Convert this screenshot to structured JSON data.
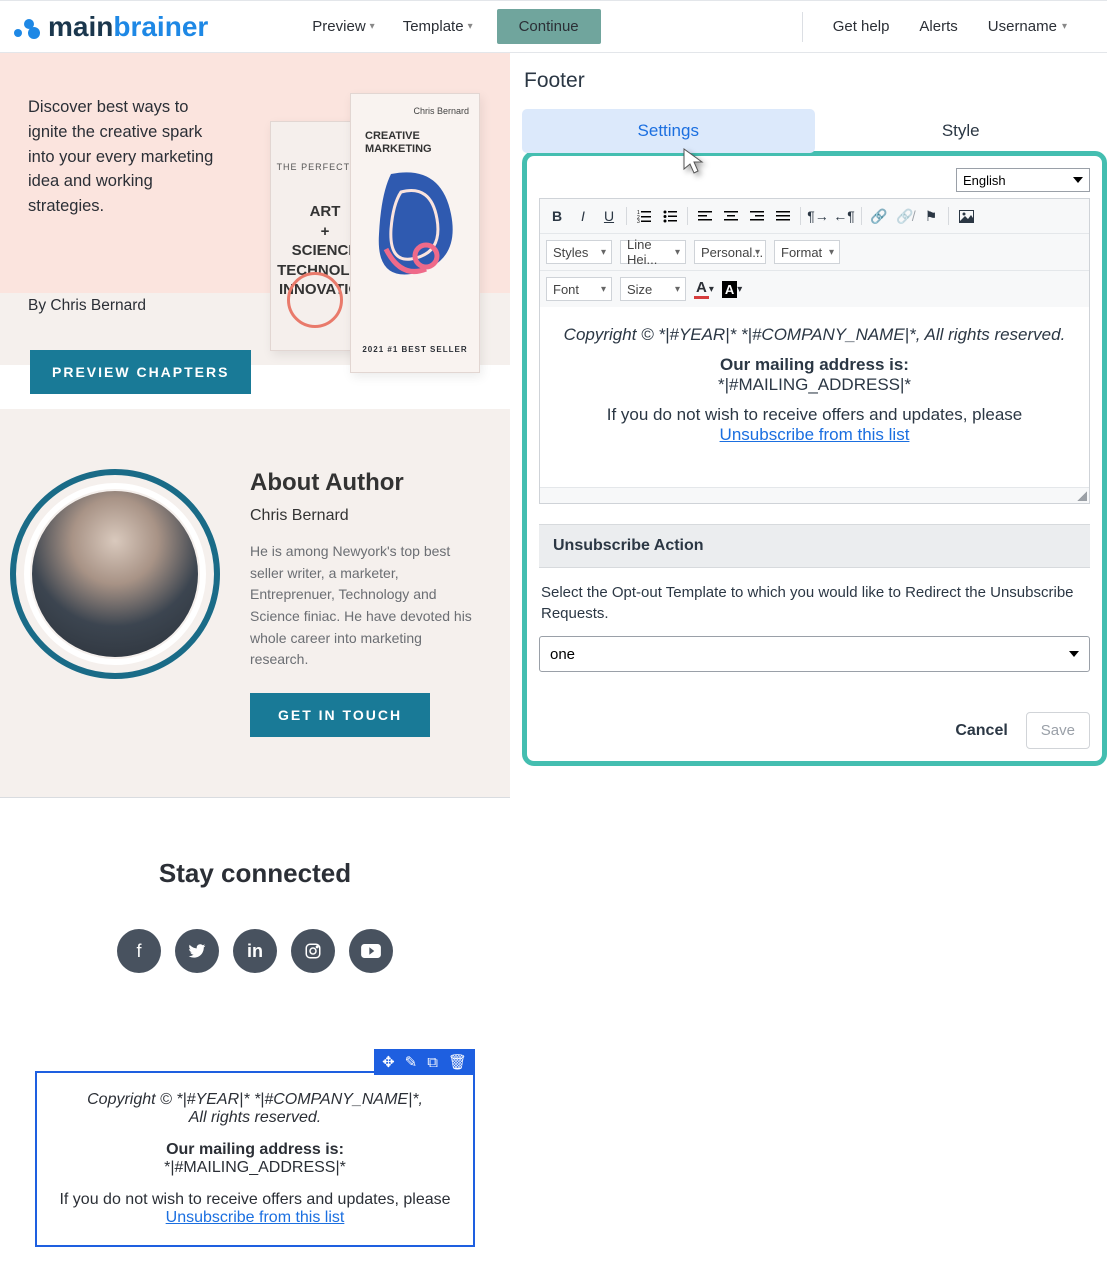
{
  "topbar": {
    "logo_main": "main",
    "logo_brain": "brainer",
    "preview": "Preview",
    "template": "Template",
    "continue": "Continue",
    "get_help": "Get help",
    "alerts": "Alerts",
    "username": "Username"
  },
  "hero": {
    "text": "Discover best ways to ignite the creative spark into your every marketing idea and working strategies.",
    "by": "By Chris Bernard",
    "book_back_sub": "THE PERFECT BLE",
    "book_back_art": "ART\n+\nSCIENCE\nTECHNOLOG\nINNOVATION",
    "book_front_author": "Chris Bernard",
    "book_front_title": "CREATIVE\nMARKETING",
    "book_front_bs": "2021 #1 BEST SELLER",
    "preview_btn": "PREVIEW CHAPTERS"
  },
  "about": {
    "h": "About Author",
    "name": "Chris Bernard",
    "bio": "He is among Newyork's top best seller writer, a marketer, Entreprenuer, Technology and Science finiac. He have devoted his whole career into marketing research.",
    "btn": "GET IN TOUCH"
  },
  "stay": {
    "h": "Stay connected"
  },
  "footer_block": {
    "copy": "Copyright © *|#YEAR|* *|#COMPANY_NAME|*,",
    "rights": "All rights reserved.",
    "mail_h": "Our mailing address is:",
    "mail_v": "*|#MAILING_ADDRESS|*",
    "wish": "If you do not wish to receive offers and updates, please",
    "unsub": "Unsubscribe from this list"
  },
  "panel": {
    "title": "Footer",
    "tab_settings": "Settings",
    "tab_style": "Style",
    "language": "English",
    "rte": {
      "styles": "Styles",
      "lh": "Line Hei...",
      "pers": "Personal...",
      "fmt": "Format",
      "font": "Font",
      "size": "Size",
      "copy": "Copyright © *|#YEAR|* *|#COMPANY_NAME|*, All rights reserved.",
      "mail_h": "Our mailing address is:",
      "mail_v": "*|#MAILING_ADDRESS|*",
      "wish": "If you do not wish to receive offers and updates, please",
      "unsub": "Unsubscribe from this list"
    },
    "unsub_h": "Unsubscribe Action",
    "unsub_txt": "Select the Opt-out Template to which you would like to Redirect the Unsubscribe Requests.",
    "template_value": "one",
    "cancel": "Cancel",
    "save": "Save"
  }
}
